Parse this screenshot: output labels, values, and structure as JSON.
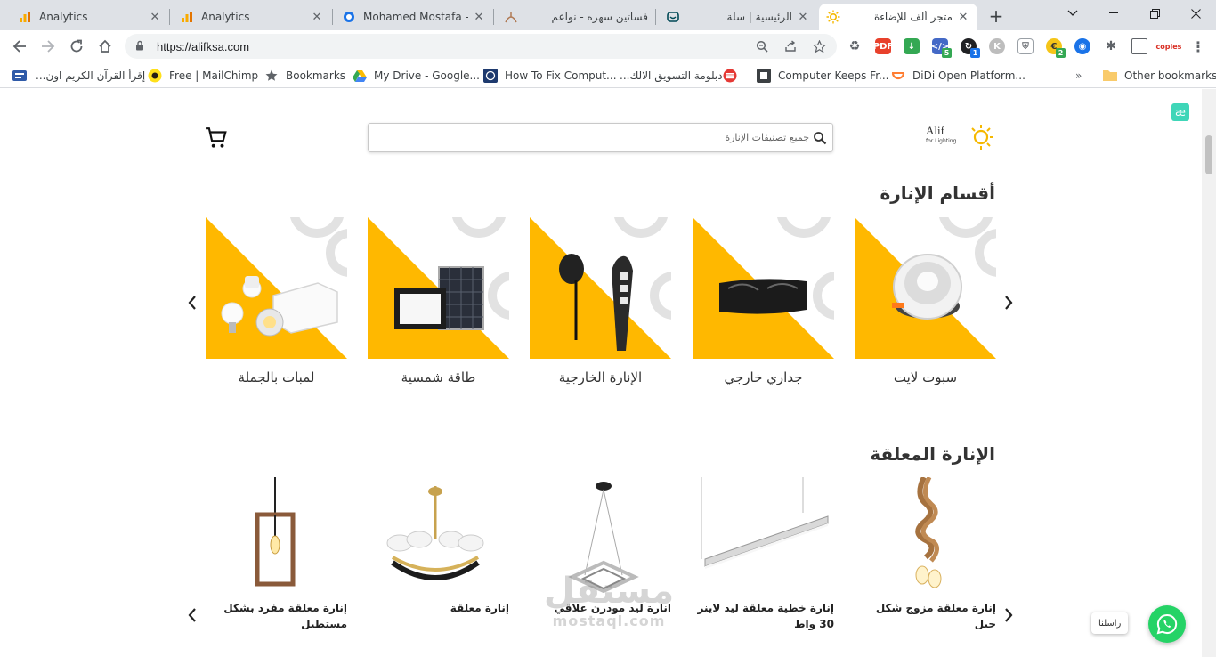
{
  "browser": {
    "tabs": [
      {
        "title": "Analytics",
        "icon": "analytics-icon"
      },
      {
        "title": "Analytics",
        "icon": "analytics-icon"
      },
      {
        "title": "Mohamed Mostafa - ",
        "icon": "profile-icon"
      },
      {
        "title": "فساتين سهره - نواعم",
        "icon": "dress-icon"
      },
      {
        "title": "الرئيسية | سلة",
        "icon": "salla-icon"
      },
      {
        "title": "متجر ألف للإضاءة",
        "icon": "sun-icon",
        "active": true
      }
    ],
    "url": "https://alifksa.com",
    "extension_badges": {
      "whatsapp": "5",
      "sync": "1",
      "coin": "2"
    },
    "bookmarks": [
      {
        "label": "",
        "icon": "apps-icon"
      },
      {
        "label": "إقرأ القرآن الكريم اون...",
        "icon": "quran-icon"
      },
      {
        "label": "Free | MailChimp",
        "icon": "mailchimp-icon"
      },
      {
        "label": "Bookmarks",
        "icon": "star-icon"
      },
      {
        "label": "My Drive - Google...",
        "icon": "drive-icon"
      },
      {
        "label": "How To Fix Comput...",
        "icon": "globe-icon"
      },
      {
        "label": "دبلومة التسويق الالك...",
        "icon": "e-logo-icon"
      },
      {
        "label": "Computer Keeps Fr...",
        "icon": "square-icon"
      },
      {
        "label": "DiDi Open Platform...",
        "icon": "didi-icon"
      }
    ],
    "bookmarks_more": "»",
    "other_bookmarks": "Other bookmarks"
  },
  "site": {
    "logo_text": "Alif",
    "logo_subtext": "for Lighting",
    "search_placeholder": "جميع تصنيفات الإنارة",
    "categories_title": "أقسام الإنارة",
    "categories": [
      {
        "name": "سبوت لايت",
        "icon": "spotlight-icon"
      },
      {
        "name": "جداري خارجي",
        "icon": "wall-light-icon"
      },
      {
        "name": "الإنارة الخارجية",
        "icon": "outdoor-light-icon"
      },
      {
        "name": "طاقة شمسية",
        "icon": "solar-panel-icon"
      },
      {
        "name": "لمبات بالجملة",
        "icon": "bulbs-icon"
      }
    ],
    "hanging_title": "الإنارة المعلقة",
    "products": [
      {
        "name": "إنارة معلقة مزوج شكل حبل"
      },
      {
        "name": "إنارة خطية معلقة ليد لاينر 30 واط"
      },
      {
        "name": "انارة ليد مودرن علاقي"
      },
      {
        "name": "إنارة معلقة"
      },
      {
        "name": "إنارة معلقة مفرد بشكل مستطيل"
      }
    ],
    "watermark_ar": "مستقل",
    "watermark_en": "mostaql.com",
    "whatsapp_label": "راسلنا",
    "accent": "#ffb800"
  }
}
